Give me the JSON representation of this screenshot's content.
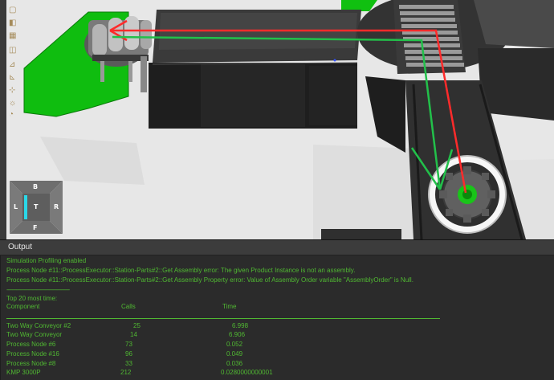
{
  "output": {
    "title": "Output",
    "lines": [
      "Simulation Profiling enabled",
      "Process Node #11::ProcessExecutor::Station-Parts#2::Get Assembly error: The given Product Instance is not an assembly.",
      "Process Node #11::ProcessExecutor::Station-Parts#2::Get Assembly Property error: Value of Assembly Order variable \"AssemblyOrder\" is Null.",
      "-----------------------------------------------",
      "Top 20 most time:"
    ],
    "table": {
      "headers": [
        "Component",
        "Calls",
        "Time"
      ],
      "rows": [
        [
          "Two Way Conveyor #2",
          "25",
          "6.998"
        ],
        [
          "Two Way Conveyor",
          "14",
          "6.906"
        ],
        [
          "Process Node #6",
          "73",
          "0.052"
        ],
        [
          "Process Node #16",
          "96",
          "0.049"
        ],
        [
          "Process Node #8",
          "33",
          "0.036"
        ],
        [
          "KMP 3000P",
          "212",
          "0.0280000000001"
        ]
      ]
    }
  },
  "navcube": {
    "top": "B",
    "left": "L",
    "center": "T",
    "right": "R",
    "bottom": "F"
  },
  "colors": {
    "log_text": "#50b832",
    "panel_bg": "#2b2b2b",
    "floor_green": "#13c213",
    "path_red": "#ff2b2b",
    "path_green": "#22c04a"
  },
  "icons": [
    "frame-icon",
    "camera-icon",
    "grid-icon",
    "snap-icon",
    "measure-icon",
    "axis-icon",
    "selection-icon",
    "light-icon",
    "render-icon",
    "material-icon"
  ]
}
